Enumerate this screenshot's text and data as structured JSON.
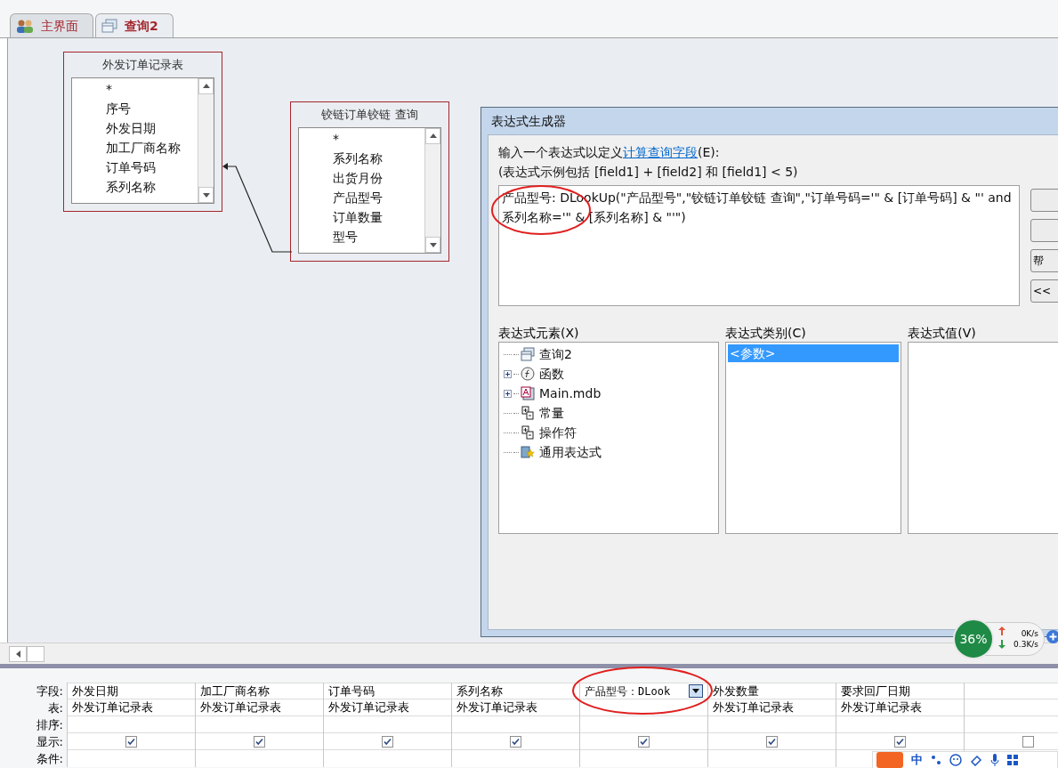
{
  "tabs": [
    {
      "label": "主界面",
      "selected": false,
      "kind": "users"
    },
    {
      "label": "查询2",
      "selected": true,
      "kind": "query"
    }
  ],
  "tables": [
    {
      "title": "外发订单记录表",
      "fields": [
        "*",
        "序号",
        "外发日期",
        "加工厂商名称",
        "订单号码",
        "系列名称"
      ]
    },
    {
      "title": "铰链订单铰链 查询",
      "fields": [
        "*",
        "系列名称",
        "出货月份",
        "产品型号",
        "订单数量",
        "型号"
      ]
    }
  ],
  "dialog": {
    "title": "表达式生成器",
    "prompt": "输入一个表达式以定义",
    "link": "计算查询字段",
    "prompt_end": "(E):",
    "example": "(表达式示例包括 [field1] + [field2] 和 [field1] < 5)",
    "expression": "产品型号: DLookUp(\"产品型号\",\"铰链订单铰链 查询\",\"订单号码='\" & [订单号码] & \"' and 系列名称='\" & [系列名称] & \"'\")",
    "side_buttons": [
      {
        "kind": "blank"
      },
      {
        "kind": "blank"
      },
      {
        "kind": "text",
        "label": "帮"
      },
      {
        "kind": "text",
        "label": "<<"
      }
    ],
    "elements": {
      "heading": "表达式元素(X)",
      "items": [
        {
          "label": "查询2",
          "kind": "query",
          "expandable": false
        },
        {
          "label": "函数",
          "kind": "function",
          "expandable": true
        },
        {
          "label": "Main.mdb",
          "kind": "database",
          "expandable": true
        },
        {
          "label": "常量",
          "kind": "constant",
          "expandable": false
        },
        {
          "label": "操作符",
          "kind": "constant",
          "expandable": false
        },
        {
          "label": "通用表达式",
          "kind": "common",
          "expandable": false
        }
      ]
    },
    "categories": {
      "heading": "表达式类别(C)",
      "items": [
        {
          "label": "<参数>",
          "selected": true
        }
      ]
    },
    "values": {
      "heading": "表达式值(V)"
    }
  },
  "grid": {
    "row_labels": [
      "字段:",
      "表:",
      "排序:",
      "显示:",
      "条件:"
    ],
    "columns": [
      {
        "field": "外发日期",
        "table": "外发订单记录表",
        "show": true,
        "kind": "text"
      },
      {
        "field": "加工厂商名称",
        "table": "外发订单记录表",
        "show": true,
        "kind": "text"
      },
      {
        "field": "订单号码",
        "table": "外发订单记录表",
        "show": true,
        "kind": "text"
      },
      {
        "field": "系列名称",
        "table": "外发订单记录表",
        "show": true,
        "kind": "text"
      },
      {
        "field": "产品型号：DLook",
        "show": true,
        "kind": "dropdown"
      },
      {
        "field": "外发数量",
        "table": "外发订单记录表",
        "show": true,
        "kind": "text"
      },
      {
        "field": "要求回厂日期",
        "table": "外发订单记录表",
        "show": true,
        "kind": "text"
      },
      {
        "show": false,
        "kind": "empty"
      }
    ]
  },
  "network": {
    "percent": "36%",
    "up": "0K/s",
    "down": "0.3K/s"
  },
  "ime": {
    "mode": "中"
  }
}
